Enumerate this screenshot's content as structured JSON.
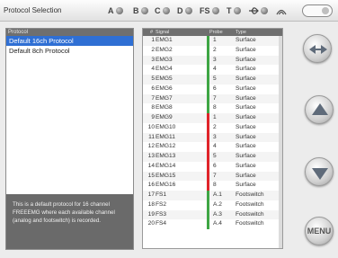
{
  "window": {
    "title": "Protocol Selection"
  },
  "status_channels": [
    "A",
    "B",
    "C",
    "D",
    "FS",
    "T",
    ""
  ],
  "colors": {
    "selected": "#2f6fd4",
    "green": "#3ea644",
    "red": "#e0242a"
  },
  "protocols": {
    "header": "Protocol",
    "items": [
      {
        "label": "Default 16ch Protocol",
        "selected": true
      },
      {
        "label": "Default 8ch Protocol",
        "selected": false
      }
    ],
    "description": "This is a default protocol for 16 channel FREEEMG where each available channel (analog and footswitch) is recorded."
  },
  "table": {
    "headers": {
      "num": "#",
      "signal": "Signal",
      "probe": "Probe",
      "type": "Type"
    },
    "rows": [
      {
        "num": "1",
        "signal": "EMG1",
        "probe": "1",
        "type": "Surface",
        "color": "green"
      },
      {
        "num": "2",
        "signal": "EMG2",
        "probe": "2",
        "type": "Surface",
        "color": "green"
      },
      {
        "num": "3",
        "signal": "EMG3",
        "probe": "3",
        "type": "Surface",
        "color": "green"
      },
      {
        "num": "4",
        "signal": "EMG4",
        "probe": "4",
        "type": "Surface",
        "color": "green"
      },
      {
        "num": "5",
        "signal": "EMG5",
        "probe": "5",
        "type": "Surface",
        "color": "green"
      },
      {
        "num": "6",
        "signal": "EMG6",
        "probe": "6",
        "type": "Surface",
        "color": "green"
      },
      {
        "num": "7",
        "signal": "EMG7",
        "probe": "7",
        "type": "Surface",
        "color": "green"
      },
      {
        "num": "8",
        "signal": "EMG8",
        "probe": "8",
        "type": "Surface",
        "color": "green"
      },
      {
        "num": "9",
        "signal": "EMG9",
        "probe": "1",
        "type": "Surface",
        "color": "red"
      },
      {
        "num": "10",
        "signal": "EMG10",
        "probe": "2",
        "type": "Surface",
        "color": "red"
      },
      {
        "num": "11",
        "signal": "EMG11",
        "probe": "3",
        "type": "Surface",
        "color": "red"
      },
      {
        "num": "12",
        "signal": "EMG12",
        "probe": "4",
        "type": "Surface",
        "color": "red"
      },
      {
        "num": "13",
        "signal": "EMG13",
        "probe": "5",
        "type": "Surface",
        "color": "red"
      },
      {
        "num": "14",
        "signal": "EMG14",
        "probe": "6",
        "type": "Surface",
        "color": "red"
      },
      {
        "num": "15",
        "signal": "EMG15",
        "probe": "7",
        "type": "Surface",
        "color": "red"
      },
      {
        "num": "16",
        "signal": "EMG16",
        "probe": "8",
        "type": "Surface",
        "color": "red"
      },
      {
        "num": "17",
        "signal": "FS1",
        "probe": "A.1",
        "type": "Footswitch",
        "color": "green"
      },
      {
        "num": "18",
        "signal": "FS2",
        "probe": "A.2",
        "type": "Footswitch",
        "color": "green"
      },
      {
        "num": "19",
        "signal": "FS3",
        "probe": "A.3",
        "type": "Footswitch",
        "color": "green"
      },
      {
        "num": "20",
        "signal": "FS4",
        "probe": "A.4",
        "type": "Footswitch",
        "color": "green"
      }
    ]
  },
  "buttons": {
    "menu_label": "MENU",
    "icons": [
      "swap-arrows-icon",
      "up-arrow-icon",
      "down-arrow-icon"
    ]
  }
}
